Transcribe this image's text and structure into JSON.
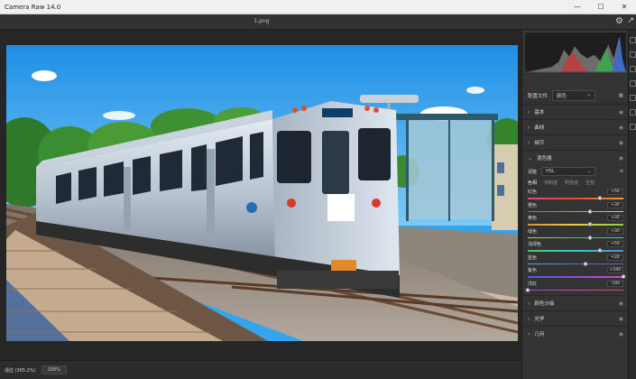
{
  "window": {
    "title": "Camera Raw 14.0",
    "filename": "1.png"
  },
  "bottom": {
    "label": "适应 (365.2%)",
    "zoom": "100%"
  },
  "panel": {
    "profile_label": "配置文件",
    "profile_value": "颜色",
    "sections_top": [
      "基本",
      "曲线",
      "细节",
      "混色器"
    ],
    "hsl_adjust_label": "调整",
    "hsl_adjust_value": "HSL",
    "tabs": [
      "色相",
      "饱和度",
      "明亮度",
      "全部"
    ],
    "sliders": [
      {
        "label": "红色",
        "value": "+50",
        "fraction": 0.75,
        "gradient": [
          "#d94a7a",
          "#e24a3a",
          "#e8a040"
        ]
      },
      {
        "label": "橙色",
        "value": "+30",
        "fraction": 0.65,
        "gradient": [
          "#e04848",
          "#e8863a",
          "#e8d040"
        ]
      },
      {
        "label": "黄色",
        "value": "+30",
        "fraction": 0.65,
        "gradient": [
          "#e88a3a",
          "#e8d040",
          "#8ad040"
        ]
      },
      {
        "label": "绿色",
        "value": "+30",
        "fraction": 0.65,
        "gradient": [
          "#c8d040",
          "#48c848",
          "#40c8a8"
        ]
      },
      {
        "label": "浅绿色",
        "value": "+50",
        "fraction": 0.75,
        "gradient": [
          "#48c860",
          "#40c8c8",
          "#4890e0"
        ]
      },
      {
        "label": "蓝色",
        "value": "+20",
        "fraction": 0.6,
        "gradient": [
          "#40c8c8",
          "#4870e0",
          "#8048e0"
        ]
      },
      {
        "label": "紫色",
        "value": "+100",
        "fraction": 1.0,
        "gradient": [
          "#4860e0",
          "#9048e0",
          "#d048c8"
        ]
      },
      {
        "label": "洋红",
        "value": "-100",
        "fraction": 0.0,
        "gradient": [
          "#9048e0",
          "#d048b0",
          "#e04860"
        ]
      }
    ],
    "sections_bottom": [
      "颜色分级",
      "光学",
      "几何"
    ]
  }
}
